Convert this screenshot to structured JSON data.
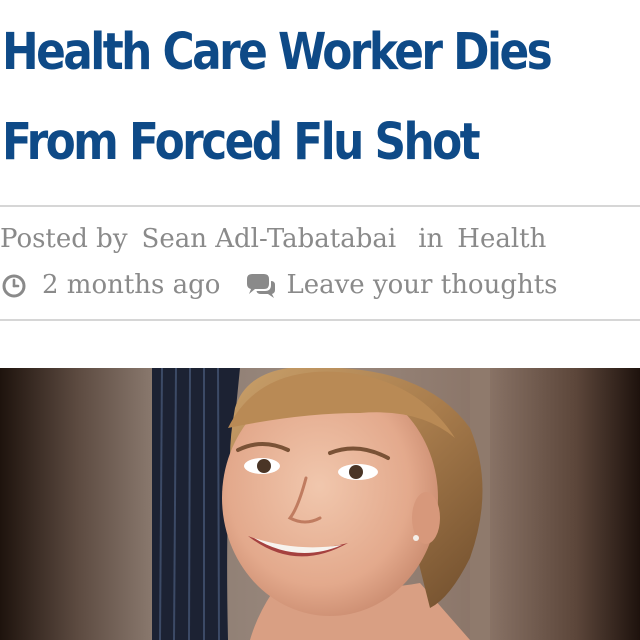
{
  "article": {
    "headline_line1": "Health Care Worker Dies",
    "headline_line2": "From Forced Flu Shot",
    "posted_by_label": "Posted by",
    "author": "Sean Adl-Tabatabai",
    "in_label": "in",
    "category": "Health",
    "time_ago": "2 months ago",
    "comments_link": "Leave your thoughts"
  },
  "icons": {
    "clock": "clock-icon",
    "comments": "comments-icon"
  },
  "colors": {
    "headline": "#0e4a87",
    "meta_text": "#8a8a8a",
    "divider": "#d6d6d6"
  },
  "image": {
    "subject": "smiling young woman with blonde hair"
  }
}
